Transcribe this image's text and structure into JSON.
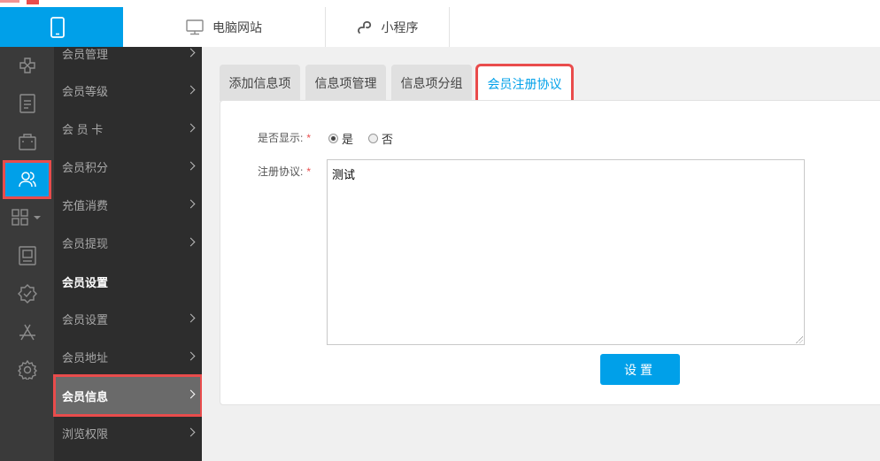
{
  "top_nav": {
    "mobile_icon": "mobile-phone-icon",
    "pc_label": "电脑网站",
    "pc_icon": "monitor-icon",
    "mini_label": "小程序",
    "mini_icon": "mini-program-icon",
    "accent_color": "#00a0e9"
  },
  "icon_bar": {
    "items": [
      {
        "icon": "design-tools-icon"
      },
      {
        "icon": "document-icon"
      },
      {
        "icon": "shop-bag-icon"
      },
      {
        "icon": "members-icon",
        "active": true
      },
      {
        "icon": "grid-apps-icon"
      },
      {
        "icon": "report-icon"
      },
      {
        "icon": "certified-badge-icon"
      },
      {
        "icon": "app-store-icon"
      },
      {
        "icon": "settings-gear-icon"
      }
    ]
  },
  "submenu": {
    "items": [
      {
        "label": "会员管理"
      },
      {
        "label": "会员等级"
      },
      {
        "label": "会 员 卡"
      },
      {
        "label": "会员积分"
      },
      {
        "label": "充值消费"
      },
      {
        "label": "会员提现"
      },
      {
        "label": "会员设置",
        "header": true
      },
      {
        "label": "会员设置"
      },
      {
        "label": "会员地址"
      },
      {
        "label": "会员信息",
        "active": true
      },
      {
        "label": "浏览权限"
      }
    ]
  },
  "tabs": [
    {
      "label": "添加信息项"
    },
    {
      "label": "信息项管理"
    },
    {
      "label": "信息项分组"
    },
    {
      "label": "会员注册协议",
      "active": true
    }
  ],
  "form": {
    "show_label": "是否显示:",
    "required_mark": "*",
    "option_yes": "是",
    "option_no": "否",
    "selected": "是",
    "agreement_label": "注册协议:",
    "agreement_value": "测试",
    "submit_label": "设置"
  }
}
